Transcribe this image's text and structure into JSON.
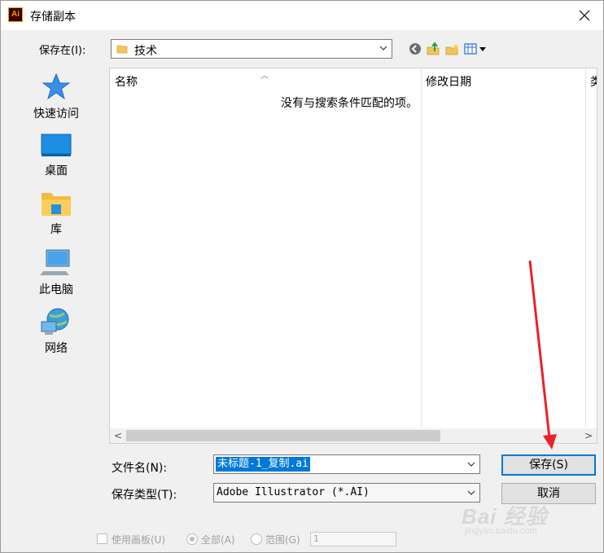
{
  "window": {
    "title": "存储副本",
    "app_icon_text": "Ai"
  },
  "save_in": {
    "label": "保存在(I):",
    "value": "技术"
  },
  "places": [
    {
      "label": "快速访问",
      "icon": "star-icon"
    },
    {
      "label": "桌面",
      "icon": "desktop-icon"
    },
    {
      "label": "库",
      "icon": "library-folder-icon"
    },
    {
      "label": "此电脑",
      "icon": "computer-icon"
    },
    {
      "label": "网络",
      "icon": "network-icon"
    }
  ],
  "file_list": {
    "columns": [
      "名称",
      "修改日期",
      "类"
    ],
    "empty_message": "没有与搜索条件匹配的项。"
  },
  "filename": {
    "label": "文件名(N):",
    "value": "未标题-1_复制.ai"
  },
  "filetype": {
    "label": "保存类型(T):",
    "value": "Adobe Illustrator (*.AI)"
  },
  "buttons": {
    "save": "保存(S)",
    "cancel": "取消"
  },
  "options": {
    "use_artboards": "使用画板(U)",
    "all": "全部(A)",
    "range": "范围(G)",
    "range_value": "1"
  },
  "watermark": {
    "main": "Bai 经验",
    "sub": "jingyan.baidu.com"
  },
  "colors": {
    "selection": "#0078d7",
    "annotation_arrow": "#e8232a",
    "app_icon_bg": "#330000",
    "app_icon_fg": "#ff9a00"
  }
}
